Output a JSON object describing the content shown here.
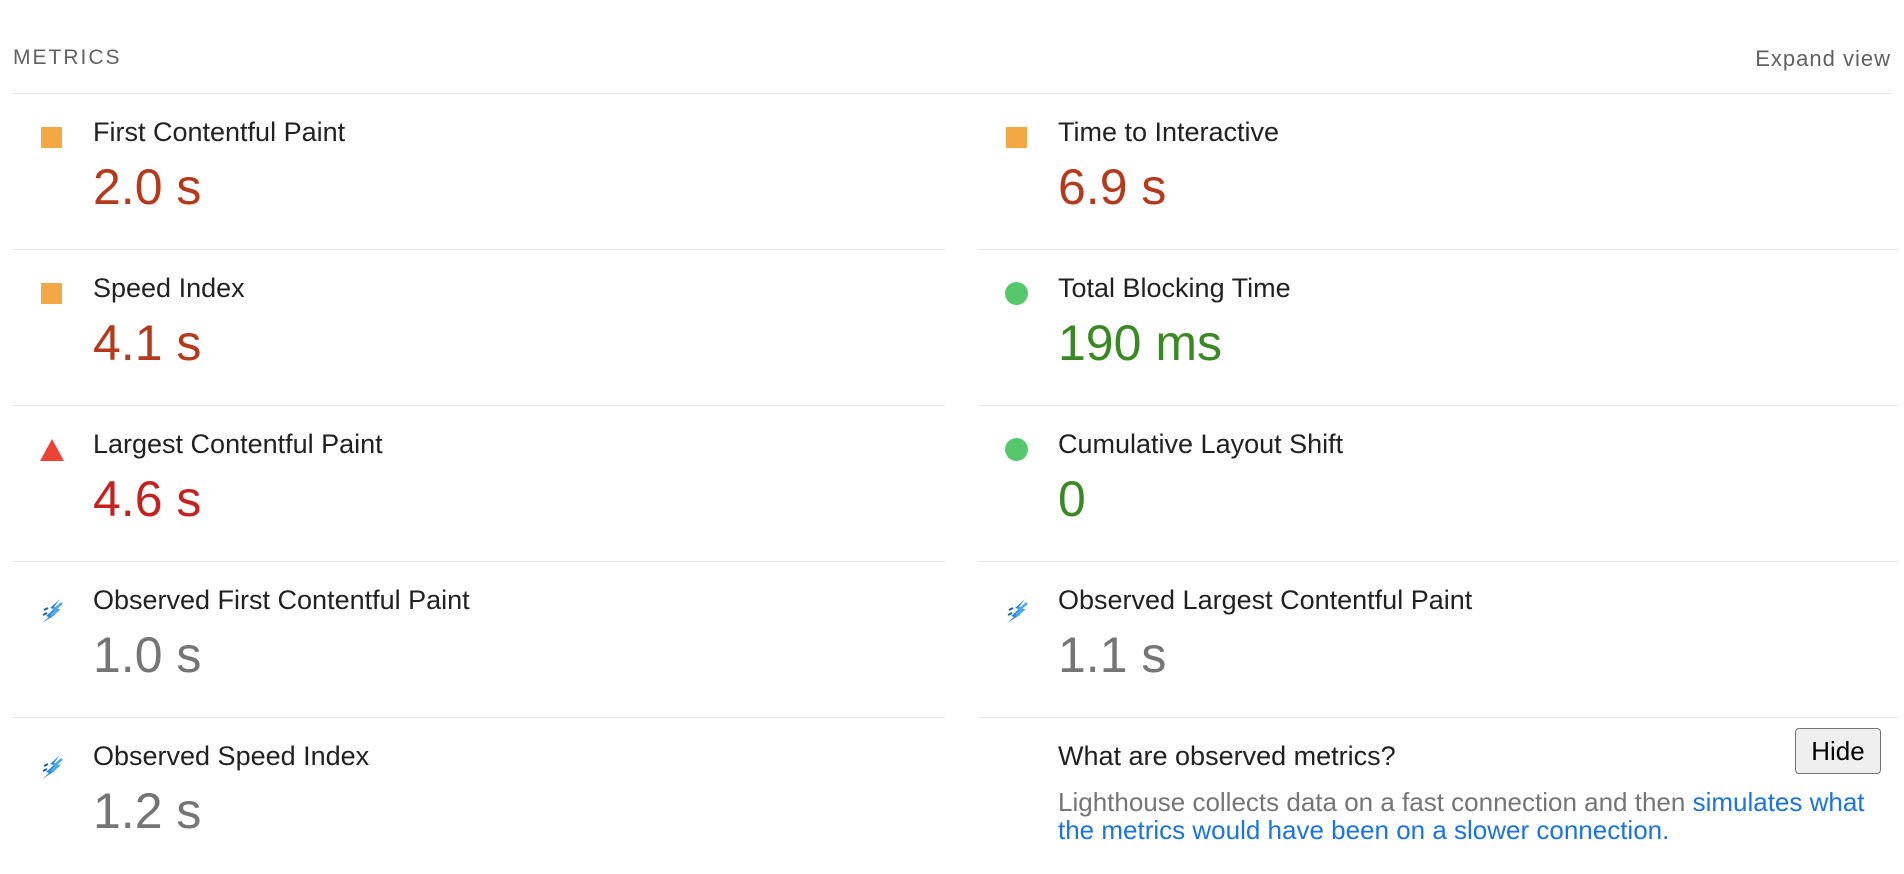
{
  "header": {
    "title": "METRICS",
    "expand_label": "Expand view"
  },
  "colors": {
    "average": "#f4a844",
    "pass": "#54c86b",
    "fail": "#eb4336",
    "value_average": "#b5391a",
    "value_fail": "#c5221f",
    "value_pass": "#3a8a23",
    "value_observed": "#757575",
    "link": "#1a73e8"
  },
  "metrics_left": [
    {
      "label": "First Contentful Paint",
      "value": "2.0 s",
      "status": "average",
      "icon": "orange-square-icon"
    },
    {
      "label": "Speed Index",
      "value": "4.1 s",
      "status": "average",
      "icon": "orange-square-icon"
    },
    {
      "label": "Largest Contentful Paint",
      "value": "4.6 s",
      "status": "fail",
      "icon": "red-triangle-icon"
    },
    {
      "label": "Observed First Contentful Paint",
      "value": "1.0 s",
      "status": "observed",
      "icon": "lightning-icon"
    },
    {
      "label": "Observed Speed Index",
      "value": "1.2 s",
      "status": "observed",
      "icon": "lightning-icon"
    }
  ],
  "metrics_right": [
    {
      "label": "Time to Interactive",
      "value": "6.9 s",
      "status": "average",
      "icon": "orange-square-icon"
    },
    {
      "label": "Total Blocking Time",
      "value": "190 ms",
      "status": "pass",
      "icon": "green-circle-icon"
    },
    {
      "label": "Cumulative Layout Shift",
      "value": "0",
      "status": "pass",
      "icon": "green-circle-icon"
    },
    {
      "label": "Observed Largest Contentful Paint",
      "value": "1.1 s",
      "status": "observed",
      "icon": "lightning-icon"
    }
  ],
  "observed_info": {
    "question": "What are observed metrics?",
    "hide_label": "Hide",
    "description_text": "Lighthouse collects data on a fast connection and then ",
    "description_link": "simulates what the metrics would have been on a slower connection."
  }
}
